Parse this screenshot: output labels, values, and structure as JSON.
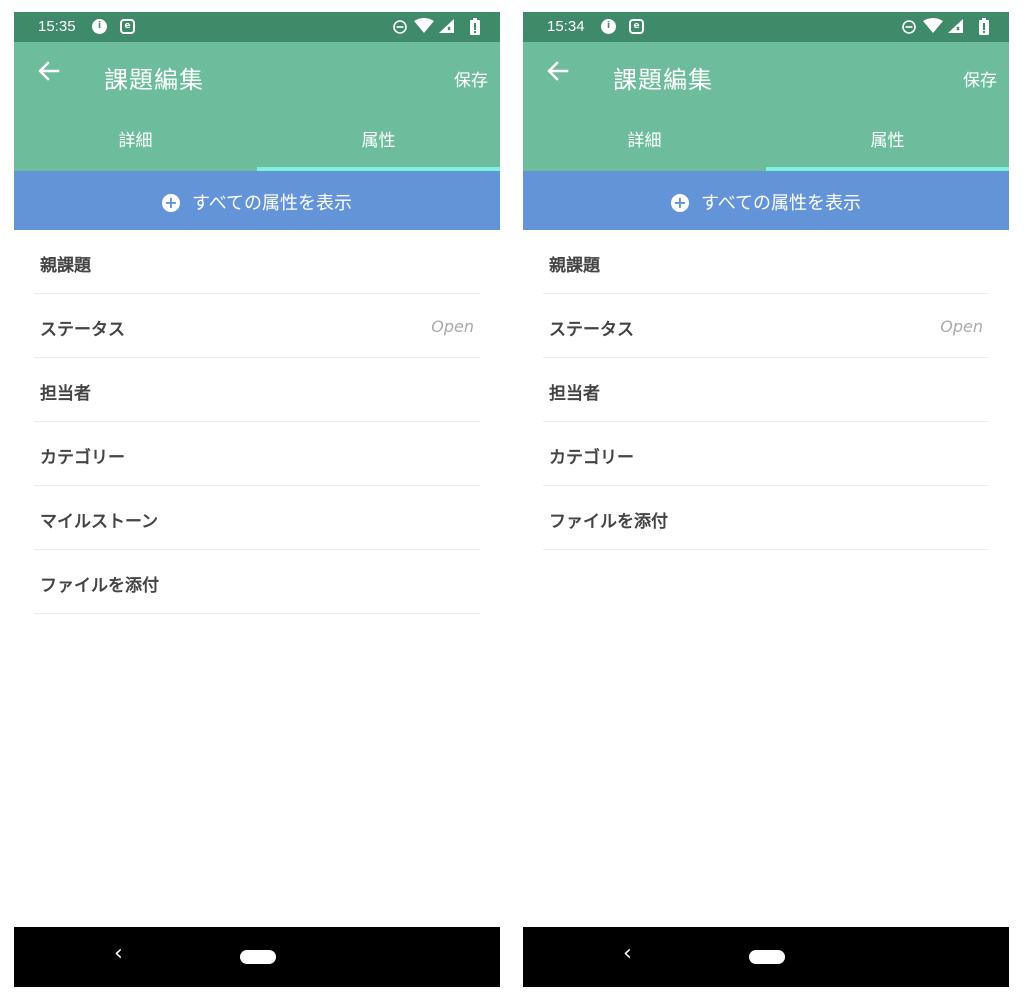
{
  "screens": [
    {
      "status": {
        "time": "15:35",
        "icon1": "info-icon",
        "icon2": "e-icon",
        "right_icons": [
          "dnd-icon",
          "wifi-icon",
          "signal-icon",
          "battery-icon"
        ]
      },
      "app_bar": {
        "title": "課題編集",
        "save_label": "保存",
        "back_icon": "back-arrow-icon"
      },
      "tabs": [
        {
          "label": "詳細"
        },
        {
          "label": "属性",
          "selected": true
        }
      ],
      "show_all": {
        "label": "すべての属性を表示",
        "icon": "plus-circle-icon"
      },
      "attributes": [
        {
          "label": "親課題",
          "value": ""
        },
        {
          "label": "ステータス",
          "value": "Open"
        },
        {
          "label": "担当者",
          "value": ""
        },
        {
          "label": "カテゴリー",
          "value": ""
        },
        {
          "label": "マイルストーン",
          "value": ""
        },
        {
          "label": "ファイルを添付",
          "value": ""
        }
      ],
      "nav": {
        "back": "‹"
      }
    },
    {
      "status": {
        "time": "15:34",
        "icon1": "info-icon",
        "icon2": "e-icon",
        "right_icons": [
          "dnd-icon",
          "wifi-icon",
          "signal-icon",
          "battery-icon"
        ]
      },
      "app_bar": {
        "title": "課題編集",
        "save_label": "保存",
        "back_icon": "back-arrow-icon"
      },
      "tabs": [
        {
          "label": "詳細"
        },
        {
          "label": "属性",
          "selected": true
        }
      ],
      "show_all": {
        "label": "すべての属性を表示",
        "icon": "plus-circle-icon"
      },
      "attributes": [
        {
          "label": "親課題",
          "value": ""
        },
        {
          "label": "ステータス",
          "value": "Open"
        },
        {
          "label": "担当者",
          "value": ""
        },
        {
          "label": "カテゴリー",
          "value": ""
        },
        {
          "label": "ファイルを添付",
          "value": ""
        }
      ],
      "nav": {
        "back": "‹"
      }
    }
  ],
  "colors": {
    "status_bar": "#3f8a68",
    "app_bar": "#6dbd9c",
    "tab_indicator": "#7df2dc",
    "show_all_bg": "#6494d8",
    "text_dark": "#444444",
    "text_muted": "#aaaaaa"
  }
}
